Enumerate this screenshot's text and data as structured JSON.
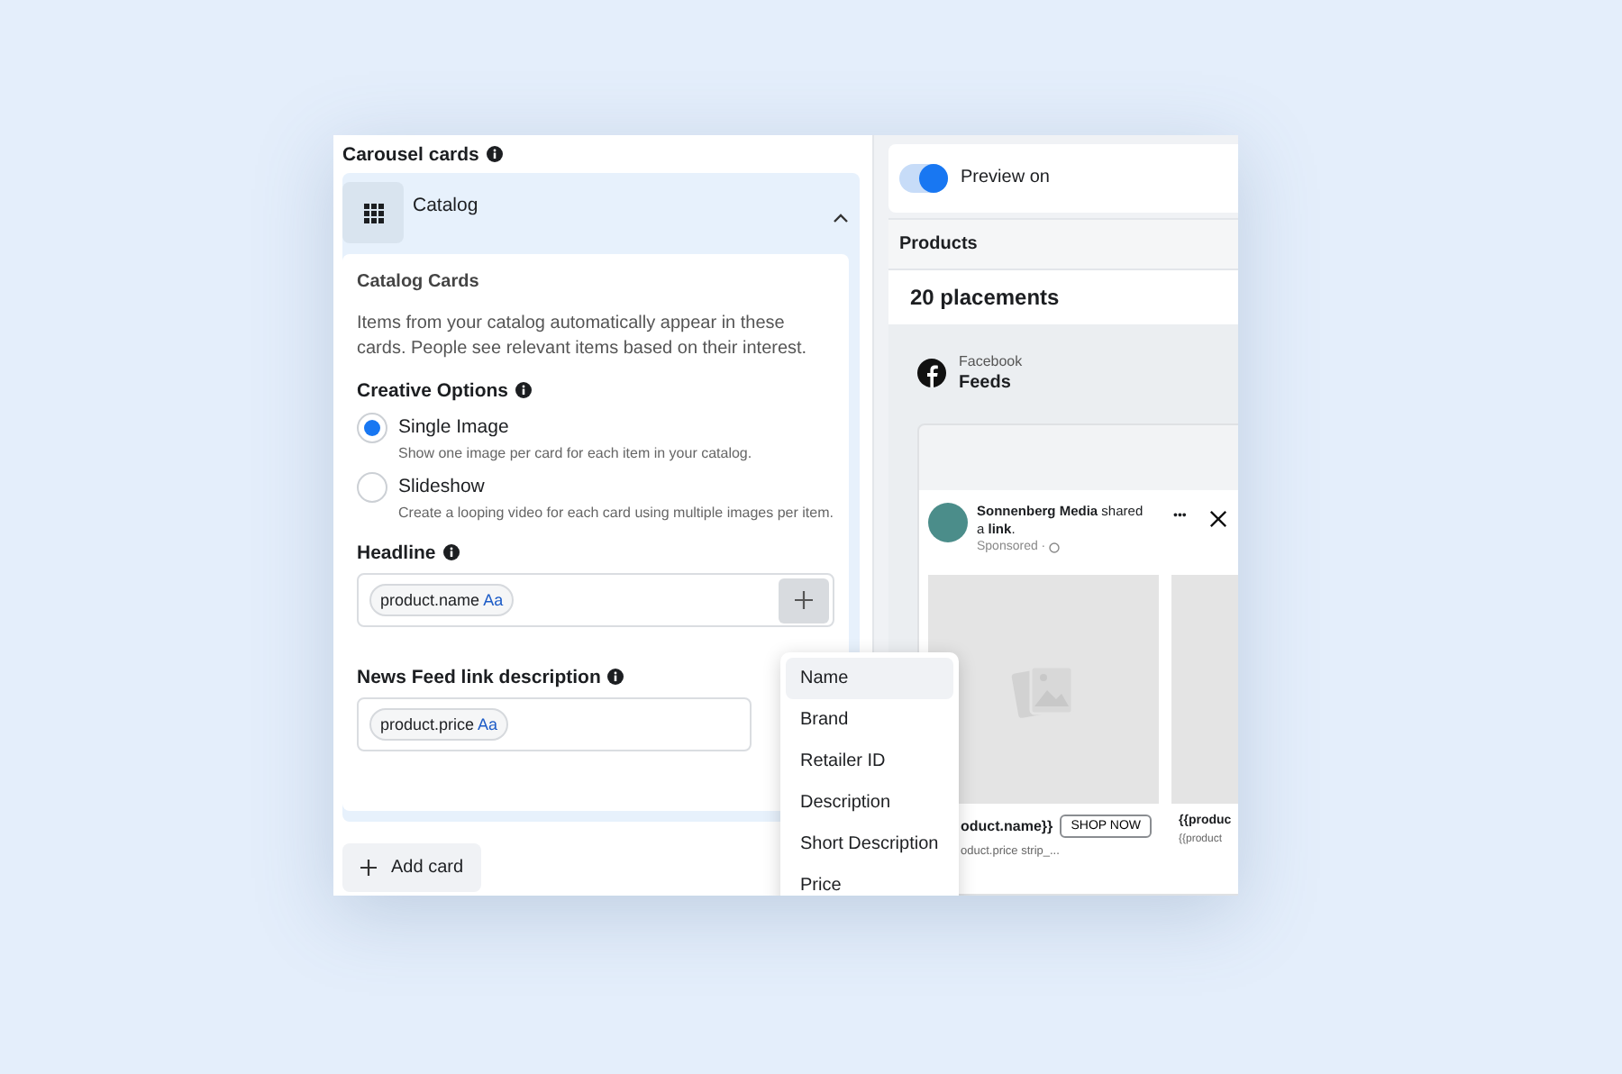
{
  "sidebar": {
    "title": "Carousel cards",
    "section": {
      "title": "Catalog",
      "expanded": true,
      "card_title": "Catalog Cards",
      "description": "Items from your catalog automatically appear in these cards. People see relevant items based on their interest.",
      "options_label": "Creative Options",
      "options": [
        {
          "label": "Single Image",
          "hint": "Show one image per card for each item in your catalog.",
          "selected": true
        },
        {
          "label": "Slideshow",
          "hint": "Create a looping video for each card using multiple images per item.",
          "selected": false
        }
      ],
      "fields": [
        {
          "label": "Headline",
          "token": "product.name",
          "token_tag": "Aa",
          "add_button": true
        },
        {
          "label": "News Feed link description",
          "token": "product.price",
          "token_tag": "Aa",
          "add_button": false
        }
      ]
    },
    "add_button": "Add card"
  },
  "menu": {
    "items": [
      {
        "label": "Name",
        "selected": true
      },
      {
        "label": "Brand",
        "selected": false
      },
      {
        "label": "Retailer ID",
        "selected": false
      },
      {
        "label": "Description",
        "selected": false
      },
      {
        "label": "Short Description",
        "selected": false
      },
      {
        "label": "Price",
        "selected": false
      }
    ]
  },
  "preview": {
    "toggle": {
      "label": "Preview on",
      "on": true
    },
    "tab": "Products",
    "placements": "20 placements",
    "placement": {
      "platform": "Facebook",
      "position": "Feeds"
    },
    "post": {
      "text": "**Sonnenberg Media** shared a **link**.",
      "sponsored": "Sponsored ·",
      "more": "•••",
      "cards": [
        {
          "title": "oduct.name}}",
          "subtitle": "oduct.price strip_...",
          "cta": "SHOP NOW"
        },
        {
          "title": "{{produc",
          "subtitle": "{{product"
        }
      ]
    }
  }
}
